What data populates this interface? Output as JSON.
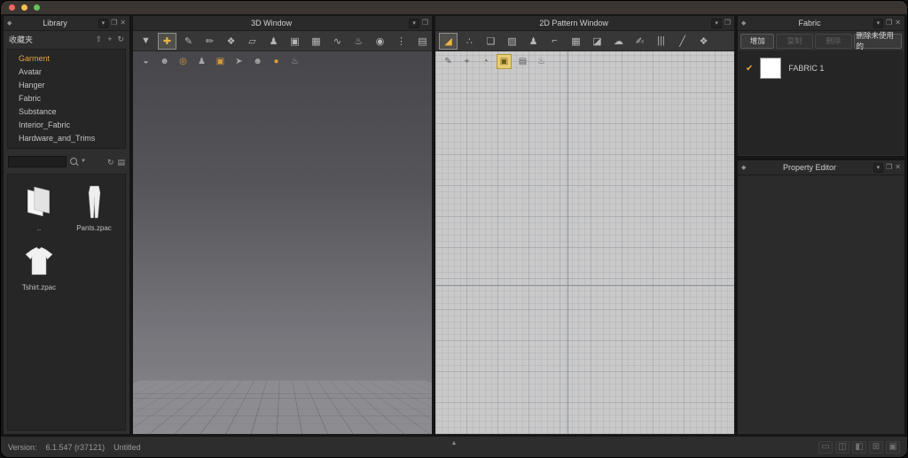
{
  "colors": {
    "accent": "#E5A33B",
    "traffic_red": "#ED6A5F",
    "traffic_yellow": "#F5BD4F",
    "traffic_green": "#61C454",
    "fabric_swatch": "#FFFFFF"
  },
  "chrome": {
    "dock_glyph": "◆",
    "float_glyph": "❐",
    "close_glyph": "✕",
    "caret_glyph": "▾"
  },
  "library": {
    "title": "Library",
    "favorites_label": "收藏夹",
    "fav_actions": [
      {
        "name": "export-icon",
        "glyph": "⇧"
      },
      {
        "name": "add-icon",
        "glyph": "+"
      },
      {
        "name": "refresh-icon",
        "glyph": "↻"
      }
    ],
    "items": [
      {
        "label": "Garment",
        "selected": true
      },
      {
        "label": "Avatar"
      },
      {
        "label": "Hanger"
      },
      {
        "label": "Fabric"
      },
      {
        "label": "Substance"
      },
      {
        "label": "Interior_Fabric"
      },
      {
        "label": "Hardware_and_Trims"
      }
    ],
    "search": {
      "placeholder": ""
    },
    "search_actions": [
      {
        "name": "refresh-icon",
        "glyph": "↻"
      },
      {
        "name": "list-view-icon",
        "glyph": "▤"
      }
    ],
    "thumbnails": [
      {
        "name": "folder-up-item",
        "label": "..",
        "type": "folder"
      },
      {
        "name": "pants-file-item",
        "label": "Pants.zpac",
        "type": "pants"
      },
      {
        "name": "tshirt-file-item",
        "label": "Tshirt.zpac",
        "type": "tshirt"
      }
    ]
  },
  "window3d": {
    "title": "3D Window",
    "tools": [
      {
        "name": "simulate-icon",
        "glyph": "▼"
      },
      {
        "name": "select-move-icon",
        "glyph": "✚",
        "selected": true
      },
      {
        "name": "pin-pen-icon",
        "glyph": "✎"
      },
      {
        "name": "sewing-pen-icon",
        "glyph": "✏"
      },
      {
        "name": "arrangement-pieces-icon",
        "glyph": "❖"
      },
      {
        "name": "fold-arrangement-icon",
        "glyph": "▱"
      },
      {
        "name": "avatar-icon",
        "glyph": "♟"
      },
      {
        "name": "reset-arrangement-icon",
        "glyph": "▣"
      },
      {
        "name": "mesh-grid-icon",
        "glyph": "▦"
      },
      {
        "name": "sewing-wire-icon",
        "glyph": "∿"
      },
      {
        "name": "steam-boot-icon",
        "glyph": "♨"
      },
      {
        "name": "sphere-tool-icon",
        "glyph": "◉"
      },
      {
        "name": "tape-icon",
        "glyph": "⋮"
      },
      {
        "name": "board-icon",
        "glyph": "▤"
      },
      {
        "name": "layers-view-icon",
        "glyph": "≋",
        "push": true
      }
    ],
    "overlay_tools": [
      {
        "name": "dark-sphere-toggle-icon",
        "glyph": "◒"
      },
      {
        "name": "avatar-head-toggle-icon",
        "glyph": "☻"
      },
      {
        "name": "ring-toggle-icon",
        "glyph": "◎",
        "accent": true
      },
      {
        "name": "figure-toggle-icon",
        "glyph": "♟"
      },
      {
        "name": "orange-doc-toggle-icon",
        "glyph": "▣",
        "accent": true
      },
      {
        "name": "cursor-toggle-icon",
        "glyph": "➤"
      },
      {
        "name": "bust-toggle-icon",
        "glyph": "☻"
      },
      {
        "name": "orange-sphere-toggle-icon",
        "glyph": "●",
        "accent": true
      },
      {
        "name": "stand-toggle-icon",
        "glyph": "♨"
      }
    ]
  },
  "window2d": {
    "title": "2D Pattern Window",
    "tools": [
      {
        "name": "transform-pattern-icon",
        "glyph": "◢",
        "selected": true
      },
      {
        "name": "edit-pattern-icon",
        "glyph": "∴"
      },
      {
        "name": "pattern-shapes-icon",
        "glyph": "❏"
      },
      {
        "name": "image-icon",
        "glyph": "▨"
      },
      {
        "name": "mannequin-icon",
        "glyph": "♟"
      },
      {
        "name": "sewing-machine-icon",
        "glyph": "⌐"
      },
      {
        "name": "texture-grid-icon",
        "glyph": "▦"
      },
      {
        "name": "iron-icon",
        "glyph": "◪"
      },
      {
        "name": "steam-cloud-icon",
        "glyph": "☁"
      },
      {
        "name": "trace-hand-icon",
        "glyph": "✍"
      },
      {
        "name": "pleats-icon",
        "glyph": "|||"
      },
      {
        "name": "stitch-line-icon",
        "glyph": "╱"
      },
      {
        "name": "tshirt-icon",
        "glyph": "❖"
      }
    ],
    "overlay_tools": [
      {
        "name": "awl-pen-icon",
        "glyph": "✎"
      },
      {
        "name": "target-icon",
        "glyph": "⌖"
      },
      {
        "name": "circle-toggle-icon",
        "glyph": "◔"
      },
      {
        "name": "pattern-toggle-icon",
        "glyph": "▣",
        "selected": true
      },
      {
        "name": "sheet-toggle-icon",
        "glyph": "▤"
      },
      {
        "name": "roller-icon",
        "glyph": "♨"
      }
    ]
  },
  "fabric": {
    "title": "Fabric",
    "buttons": [
      {
        "name": "add-fabric-button",
        "label": "增加",
        "enabled": true
      },
      {
        "name": "copy-fabric-button",
        "label": "复制",
        "enabled": false
      },
      {
        "name": "delete-fabric-button",
        "label": "删除",
        "enabled": false
      },
      {
        "name": "delete-unused-fabric-button",
        "label": "删除未使用的",
        "enabled": true
      }
    ],
    "items": [
      {
        "name": "fabric-row",
        "label": "FABRIC 1",
        "check_glyph": "✔"
      }
    ]
  },
  "property_editor": {
    "title": "Property Editor"
  },
  "statusbar": {
    "version_label": "Version:",
    "version_value": "6.1.547 (r37121)",
    "document_name": "Untitled",
    "expand_glyph": "▲",
    "layout_icons": [
      {
        "name": "layout-single-icon",
        "glyph": "▭"
      },
      {
        "name": "layout-split-icon",
        "glyph": "◫"
      },
      {
        "name": "layout-corner-icon",
        "glyph": "◧"
      },
      {
        "name": "layout-grid-icon",
        "glyph": "⊞"
      },
      {
        "name": "layout-record-icon",
        "glyph": "▣"
      }
    ]
  }
}
